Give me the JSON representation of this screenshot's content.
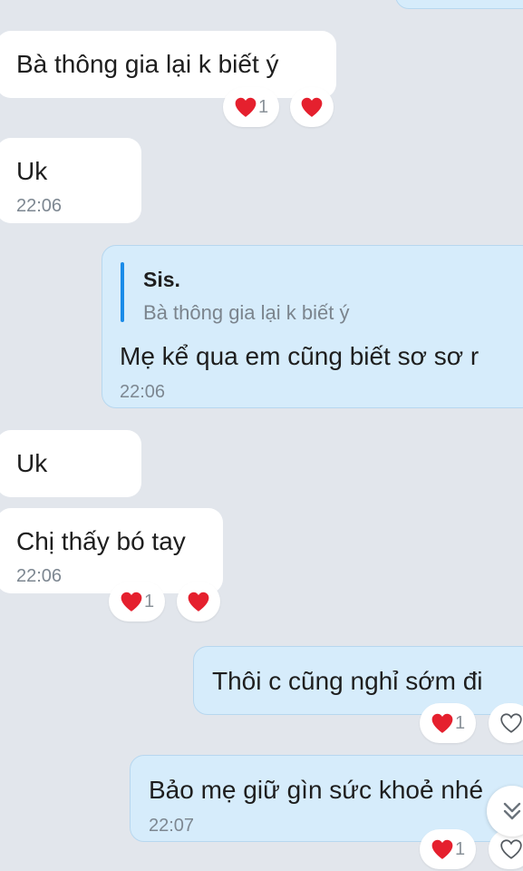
{
  "messages": [
    {
      "text": "Bà thông gia lại k biết ý",
      "reaction_count": "1"
    },
    {
      "text": "Uk",
      "time": "22:06"
    },
    {
      "quote": {
        "author": "Sis.",
        "text": "Bà thông gia lại k biết ý"
      },
      "text": "Mẹ kể qua em cũng biết sơ sơ r",
      "time": "22:06"
    },
    {
      "text": "Uk"
    },
    {
      "text": "Chị thấy bó tay",
      "time": "22:06",
      "reaction_count": "1"
    },
    {
      "text": "Thôi c cũng nghỉ sớm đi",
      "reaction_count": "1"
    },
    {
      "text": "Bảo mẹ giữ gìn sức khoẻ nhé",
      "time": "22:07",
      "reaction_count": "1"
    }
  ],
  "colors": {
    "background": "#e2e6ec",
    "incoming_bubble": "#ffffff",
    "outgoing_bubble": "#d6ecfb",
    "heart": "#e5202e",
    "quote_bar": "#1a8be8"
  },
  "icons": [
    "heart-icon",
    "heart-outline-icon",
    "chevron-double-down-icon"
  ]
}
